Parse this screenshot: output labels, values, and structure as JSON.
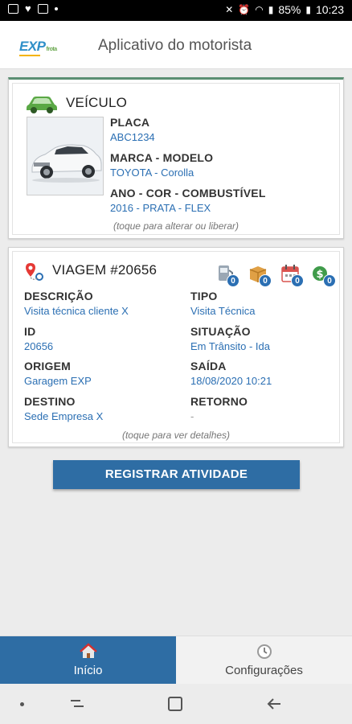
{
  "status_bar": {
    "battery": "85%",
    "time": "10:23"
  },
  "app_bar": {
    "logo_text": "EXP",
    "logo_sub": "frota",
    "title": "Aplicativo do motorista"
  },
  "vehicle": {
    "title": "VEÍCULO",
    "plate_label": "PLACA",
    "plate_value": "ABC1234",
    "brand_label": "MARCA - MODELO",
    "brand_value": "TOYOTA - Corolla",
    "year_label": "ANO - COR - COMBUSTÍVEL",
    "year_value": "2016 - PRATA - FLEX",
    "hint": "(toque para alterar ou liberar)",
    "icon": "car-icon"
  },
  "trip": {
    "title": "VIAGEM #20656",
    "icon": "map-pin-icon",
    "badges": [
      {
        "icon": "fuel-icon",
        "count": "0"
      },
      {
        "icon": "box-icon",
        "count": "0"
      },
      {
        "icon": "calendar-icon",
        "count": "0"
      },
      {
        "icon": "money-icon",
        "count": "0"
      }
    ],
    "fields": {
      "descricao_label": "DESCRIÇÃO",
      "descricao_value": "Visita técnica cliente X",
      "tipo_label": "TIPO",
      "tipo_value": "Visita Técnica",
      "id_label": "ID",
      "id_value": "20656",
      "situacao_label": "SITUAÇÃO",
      "situacao_value": "Em Trânsito - Ida",
      "origem_label": "ORIGEM",
      "origem_value": "Garagem EXP",
      "saida_label": "SAÍDA",
      "saida_value": "18/08/2020 10:21",
      "destino_label": "DESTINO",
      "destino_value": "Sede Empresa X",
      "retorno_label": "RETORNO",
      "retorno_value": "-"
    },
    "hint": "(toque para ver detalhes)"
  },
  "action_button": "REGISTRAR ATIVIDADE",
  "bottom_nav": [
    {
      "label": "Início",
      "icon": "home-icon",
      "active": true
    },
    {
      "label": "Configurações",
      "icon": "clock-icon",
      "active": false
    }
  ],
  "colors": {
    "accent": "#2e6da4",
    "link": "#2b6fb3",
    "vehicle_border": "#5c8f73"
  }
}
